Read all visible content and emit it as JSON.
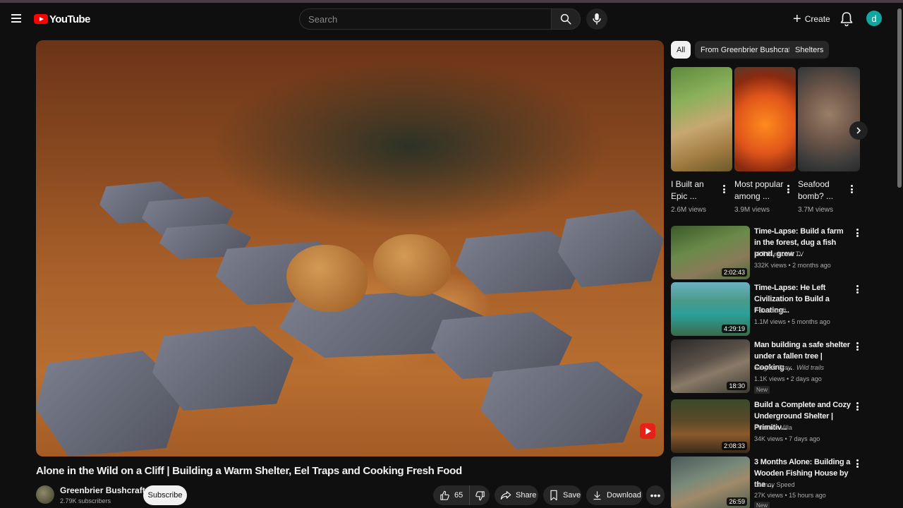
{
  "header": {
    "logo_text": "YouTube",
    "search_placeholder": "Search",
    "create_label": "Create",
    "avatar_letter": "d"
  },
  "video": {
    "title": "Alone in the Wild on a Cliff | Building a Warm Shelter, Eel Traps and Cooking Fresh Food",
    "channel": "Greenbrier Bushcraft",
    "subscribers": "2.79K subscribers",
    "subscribe_label": "Subscribe",
    "likes": "65",
    "share_label": "Share",
    "save_label": "Save",
    "download_label": "Download"
  },
  "sidebar": {
    "chips": [
      "All",
      "From Greenbrier Bushcraft",
      "Shelters"
    ],
    "shorts": [
      {
        "title": "I Built an Epic ...",
        "views": "2.6M views"
      },
      {
        "title": "Most popular among ...",
        "views": "3.9M views"
      },
      {
        "title": "Seafood bomb? ...",
        "views": "3.7M views"
      }
    ],
    "recommendations": [
      {
        "title": "Time-Lapse: Build a farm in the forest, dug a fish pond, grew ...",
        "channel": "MrT Bushcraft TV",
        "meta": "332K views • 2 months ago",
        "duration": "2:02:43",
        "badge": ""
      },
      {
        "title": "Time-Lapse: He Left Civilization to Build a Floating...",
        "channel": "7 Bushcraft",
        "meta": "1.1M views • 5 months ago",
        "duration": "4:29:19",
        "badge": ""
      },
      {
        "title": "Man building a safe shelter under a fallen tree | Cooking ...",
        "channel": "Sergius Gray . Wild trails",
        "meta": "1.1K views • 2 days ago",
        "duration": "18:30",
        "badge": "New"
      },
      {
        "title": "Build a Complete and Cozy Underground Shelter | Primitiv...",
        "channel": "Primitive Villa",
        "meta": "34K views • 7 days ago",
        "duration": "2:08:33",
        "badge": ""
      },
      {
        "title": "3 Months Alone: Building a Wooden Fishing House by the ...",
        "channel": "Lesnoy Speed",
        "meta": "27K views • 15 hours ago",
        "duration": "26:59",
        "badge": "New"
      }
    ]
  },
  "icons": {
    "menu": "hamburger-icon",
    "search": "search-icon",
    "mic": "mic-icon",
    "bell": "bell-icon",
    "like": "thumb-up-icon",
    "dislike": "thumb-down-icon",
    "share": "share-arrow-icon",
    "save": "bookmark-icon",
    "download": "download-icon",
    "more": "more-horizontal-icon"
  },
  "colors": {
    "background": "#0f0f0f",
    "brand_red": "#ff0000",
    "chip_active": "#f1f1f1",
    "avatar": "#12a6a1"
  }
}
